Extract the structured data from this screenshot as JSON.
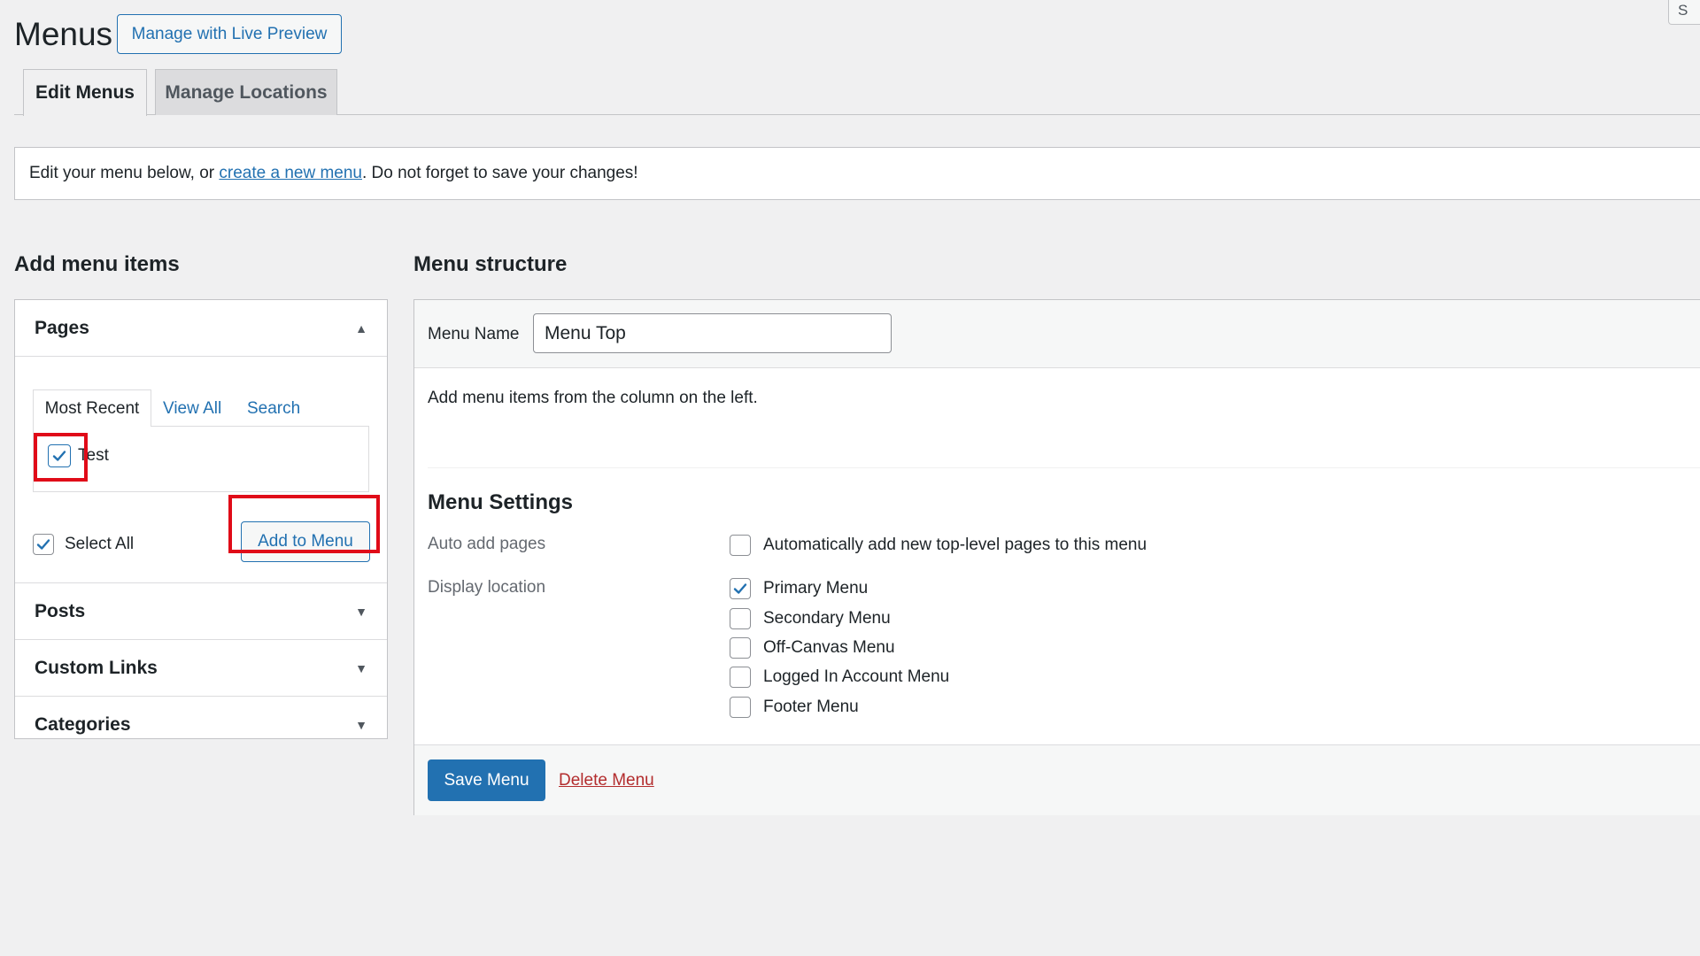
{
  "header": {
    "title": "Menus",
    "live_preview_button": "Manage with Live Preview",
    "corner_button": "S"
  },
  "tabs": [
    {
      "label": "Edit Menus",
      "active": true
    },
    {
      "label": "Manage Locations",
      "active": false
    }
  ],
  "notice": {
    "prefix": "Edit your menu below, or ",
    "link": "create a new menu",
    "suffix": ". Do not forget to save your changes!"
  },
  "add_items": {
    "heading": "Add menu items",
    "pages": {
      "title": "Pages",
      "subtabs": [
        "Most Recent",
        "View All",
        "Search"
      ],
      "items": [
        {
          "label": "Test",
          "checked": true
        }
      ],
      "select_all_label": "Select All",
      "select_all_checked": true,
      "add_button": "Add to Menu"
    },
    "sections": [
      "Posts",
      "Custom Links",
      "Categories"
    ]
  },
  "structure": {
    "heading": "Menu structure",
    "menu_name_label": "Menu Name",
    "menu_name_value": "Menu Top",
    "empty_hint": "Add menu items from the column on the left.",
    "settings_heading": "Menu Settings",
    "auto_add_label": "Auto add pages",
    "auto_add_option": {
      "label": "Automatically add new top-level pages to this menu",
      "checked": false
    },
    "display_location_label": "Display location",
    "locations": [
      {
        "label": "Primary Menu",
        "checked": true
      },
      {
        "label": "Secondary Menu",
        "checked": false
      },
      {
        "label": "Off-Canvas Menu",
        "checked": false
      },
      {
        "label": "Logged In Account Menu",
        "checked": false
      },
      {
        "label": "Footer Menu",
        "checked": false
      }
    ],
    "save_button": "Save Menu",
    "delete_link": "Delete Menu"
  },
  "colors": {
    "accent": "#2271b1",
    "delete": "#b32d2e",
    "highlight": "#e00b18",
    "background": "#f0f0f1"
  }
}
